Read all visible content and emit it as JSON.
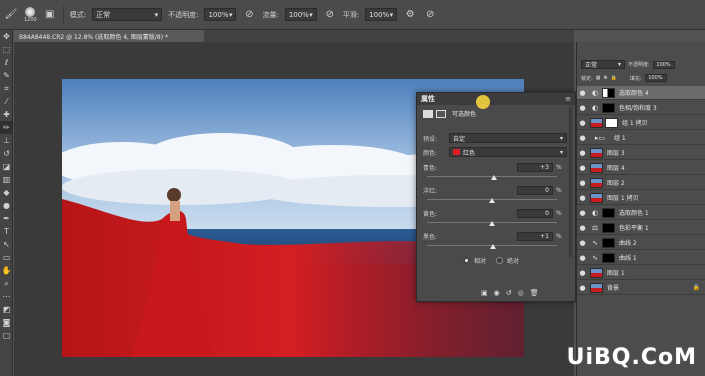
{
  "options_bar": {
    "brush_size": "1200",
    "mode_label": "模式:",
    "mode_value": "正常",
    "opacity_label": "不透明度:",
    "opacity_value": "100%",
    "flow_label": "流量:",
    "flow_value": "100%",
    "smooth_label": "平滑:",
    "smooth_value": "100%"
  },
  "document_tab": {
    "title": "B84A8448.CR2 @ 12.8% (选取颜色 4, 图层蒙版/8) *"
  },
  "properties_panel": {
    "title": "属性",
    "subtitle": "可选颜色",
    "preset_label": "预设:",
    "preset_value": "自定",
    "color_label": "颜色:",
    "color_value": "红色",
    "color_swatch": "#d8202a",
    "sliders": [
      {
        "label": "青色:",
        "value": "+3",
        "unit": "%",
        "level": 0.515
      },
      {
        "label": "洋红:",
        "value": "0",
        "unit": "%",
        "level": 0.5
      },
      {
        "label": "黄色:",
        "value": "0",
        "unit": "%",
        "level": 0.5
      },
      {
        "label": "黑色:",
        "value": "+1",
        "unit": "%",
        "level": 0.505
      }
    ],
    "radio_relative": "相对",
    "radio_absolute": "绝对",
    "relative_selected": true
  },
  "layers_panel": {
    "blend_mode": "正常",
    "opacity_label": "不透明度:",
    "opacity_value": "100%",
    "lock_label": "锁定:",
    "fill_label": "填充:",
    "fill_value": "100%",
    "layers": [
      {
        "name": "选取颜色 4",
        "type": "adjustment",
        "icon": "circle-half-icon",
        "selected": true
      },
      {
        "name": "色相/饱和度 3",
        "type": "adjustment",
        "icon": "circle-half-icon"
      },
      {
        "name": "组 1 拷贝",
        "type": "pixel"
      },
      {
        "name": "组 1",
        "type": "group"
      },
      {
        "name": "图层 3",
        "type": "pixel"
      },
      {
        "name": "图层 4",
        "type": "pixel"
      },
      {
        "name": "图层 2",
        "type": "pixel"
      },
      {
        "name": "图层 1 拷贝",
        "type": "pixel"
      },
      {
        "name": "选取颜色 1",
        "type": "adjustment",
        "icon": "circle-half-icon"
      },
      {
        "name": "色彩平衡 1",
        "type": "adjustment",
        "icon": "scales-icon"
      },
      {
        "name": "曲线 2",
        "type": "adjustment",
        "icon": "curves-icon"
      },
      {
        "name": "曲线 1",
        "type": "adjustment",
        "icon": "curves-icon"
      },
      {
        "name": "图层 1",
        "type": "pixel"
      },
      {
        "name": "背景",
        "type": "background",
        "locked": true
      }
    ]
  },
  "watermark": "UiBQ.CoM"
}
